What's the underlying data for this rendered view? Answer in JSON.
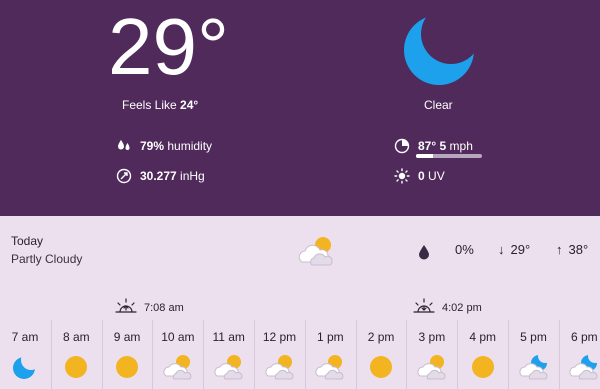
{
  "current": {
    "temperature": "29°",
    "feels_like_label": "Feels Like",
    "feels_like_value": "24°",
    "condition": "Clear",
    "condition_icon": "moon-icon",
    "humidity_value": "79%",
    "humidity_label": "humidity",
    "pressure_value": "30.277",
    "pressure_unit": "inHg",
    "wind_direction": "87°",
    "wind_speed": "5",
    "wind_unit": "mph",
    "wind_level": 0.25,
    "uv_value": "0",
    "uv_label": "UV"
  },
  "today": {
    "label": "Today",
    "condition": "Partly Cloudy",
    "icon": "partly-cloudy-icon",
    "precip": "0%",
    "low": "29°",
    "high": "38°"
  },
  "sun": {
    "sunrise": "7:08 am",
    "sunset": "4:02 pm"
  },
  "hourly": [
    {
      "time": "7 am",
      "icon": "moon"
    },
    {
      "time": "8 am",
      "icon": "sun"
    },
    {
      "time": "9 am",
      "icon": "sun"
    },
    {
      "time": "10 am",
      "icon": "partly-cloudy"
    },
    {
      "time": "11 am",
      "icon": "partly-cloudy"
    },
    {
      "time": "12 pm",
      "icon": "partly-cloudy"
    },
    {
      "time": "1 pm",
      "icon": "partly-cloudy"
    },
    {
      "time": "2 pm",
      "icon": "sun"
    },
    {
      "time": "3 pm",
      "icon": "partly-cloudy"
    },
    {
      "time": "4 pm",
      "icon": "sun"
    },
    {
      "time": "5 pm",
      "icon": "moon-cloudy"
    },
    {
      "time": "6 pm",
      "icon": "moon-cloudy"
    }
  ],
  "colors": {
    "header_bg": "#4f2a5a",
    "body_bg": "#ece0ef",
    "sun": "#f2b420",
    "moon": "#1ea1ec"
  }
}
